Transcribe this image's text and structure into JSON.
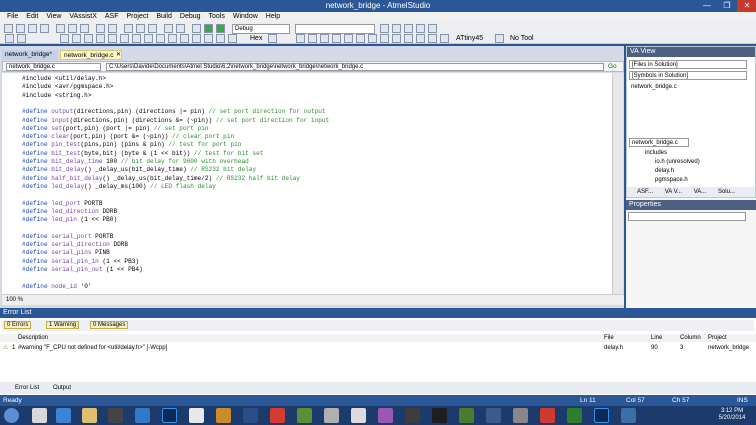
{
  "window": {
    "title": "network_bridge - AtmelStudio",
    "min": "—",
    "max": "❐",
    "close": "✕"
  },
  "menu": [
    "File",
    "Edit",
    "View",
    "VAssistX",
    "ASF",
    "Project",
    "Build",
    "Debug",
    "Tools",
    "Window",
    "Help"
  ],
  "toolbar": {
    "config": "Debug",
    "hex": "Hex",
    "device": "ATtiny45",
    "tool": "No Tool"
  },
  "doc_tabs": [
    "network_bridge*",
    "network_bridge.c"
  ],
  "nav": {
    "scope": "network_bridge.c",
    "path": "C:\\Users\\Davide\\Documents\\Atmel Studio\\6.2\\network_bridge\\network_bridge\\network_bridge.c",
    "go": "Go"
  },
  "code": [
    "#include <util/delay.h>",
    "#include <avr/pgmspace.h>",
    "#include <string.h>",
    "",
    "#define output(directions,pin) (directions |= pin) // set port direction for output",
    "#define input(directions,pin) (directions &= (~pin)) // set port direction for input",
    "#define set(port,pin) (port |= pin) // set port pin",
    "#define clear(port,pin) (port &= (~pin)) // clear port pin",
    "#define pin_test(pins,pin) (pins & pin) // test for port pin",
    "#define bit_test(byte,bit) (byte & (1 << bit)) // test for bit set",
    "#define bit_delay_time 100 // bit delay for 9600 with overhead",
    "#define bit_delay() _delay_us(bit_delay_time) // RS232 bit delay",
    "#define half_bit_delay() _delay_us(bit_delay_time/2) // RS232 half bit delay",
    "#define led_delay() _delay_ms(100) // LED flash delay",
    "",
    "#define led_port PORTB",
    "#define led_direction DDRB",
    "#define led_pin (1 << PB0)",
    "",
    "#define serial_port PORTB",
    "#define serial_direction DDRB",
    "#define serial_pins PINB",
    "#define serial_pin_in (1 << PB3)",
    "#define serial_pin_out (1 << PB4)",
    "",
    "#define node_id '0'"
  ],
  "zoom": "100 %",
  "va_view": {
    "title": "VA View",
    "filter1": "[Files in Solution]",
    "filter2": "[Symbols in Solution]",
    "file": "network_bridge.c",
    "file2": "network_bridge.c",
    "tree": [
      {
        "label": "includes"
      },
      {
        "label": "io.h (unresolved)"
      },
      {
        "label": "delay.h"
      },
      {
        "label": "pgmspace.h"
      }
    ],
    "tabs": [
      "ASF...",
      "VA V...",
      "VA...",
      "Solu..."
    ]
  },
  "properties": {
    "title": "Properties"
  },
  "error_list": {
    "title": "Error List",
    "errors": "0 Errors",
    "warnings": "1 Warning",
    "messages": "0 Messages",
    "headers": [
      "Description",
      "File",
      "Line",
      "Column",
      "Project"
    ],
    "rows": [
      {
        "num": "1",
        "desc": "#warning \"F_CPU not defined for <util/delay.h>\" [-Wcpp]",
        "file": "delay.h",
        "line": "90",
        "column": "3",
        "project": "network_bridge"
      }
    ],
    "tabs": [
      "Error List",
      "Output"
    ]
  },
  "status": {
    "ready": "Ready",
    "ln": "Ln 11",
    "col": "Col 57",
    "ch": "Ch 57",
    "ins": "INS"
  },
  "clock": {
    "time": "3:12 PM",
    "date": "5/20/2014"
  }
}
